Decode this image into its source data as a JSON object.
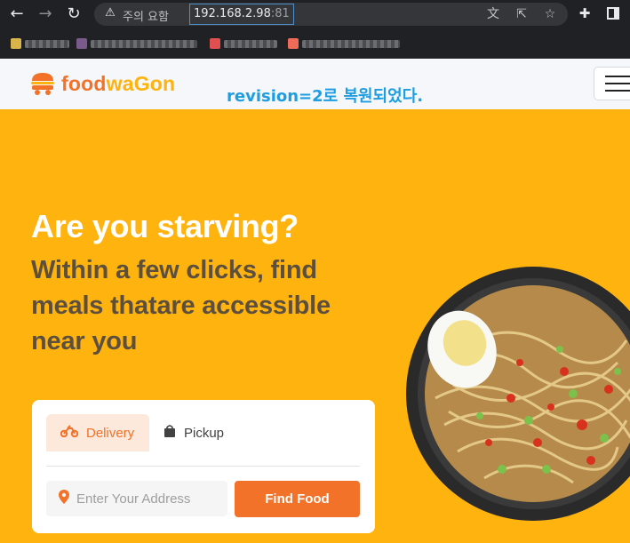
{
  "browser": {
    "security_label": "주의 요함",
    "url_host": "192.168.2.98",
    "url_port": ":81",
    "icons": [
      "back-icon",
      "forward-icon",
      "reload-icon",
      "warning-icon",
      "translate-icon",
      "share-icon",
      "star-icon",
      "extensions-icon",
      "sidepanel-icon"
    ]
  },
  "site": {
    "brand_part1": "food",
    "brand_part2": "waGon",
    "revision_note": "revision=2로 복원되었다.",
    "colors": {
      "accent": "#f17228",
      "yellow": "#ffb30e",
      "note": "#1e9ee0"
    }
  },
  "hero": {
    "title": "Are you starving?",
    "subtitle": "Within a few clicks, find meals thatare accessible near you"
  },
  "search_card": {
    "tab_delivery": "Delivery",
    "tab_pickup": "Pickup",
    "address_placeholder": "Enter Your Address",
    "find_button": "Find Food"
  }
}
